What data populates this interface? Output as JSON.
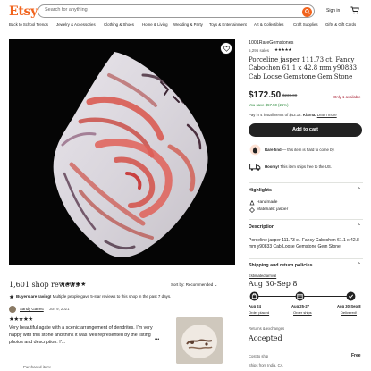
{
  "header": {
    "logo": "Etsy",
    "search_placeholder": "Search for anything",
    "sign_in": "Sign in"
  },
  "nav": [
    "Back to School Trends",
    "Jewelry & Accessories",
    "Clothing & Shoes",
    "Home & Living",
    "Wedding & Party",
    "Toys & Entertainment",
    "Art & Collectibles",
    "Craft Supplies",
    "Gifts & Gift Cards"
  ],
  "listing": {
    "shop_name": "1001RareGemstones",
    "sales": "5,296 sales",
    "rating_stars": "★★★★★",
    "title": "Porceline jasper 111.73 ct. Fancy Cabochon 61.1 x 42.8 mm y90833 Cab Loose Gemstone Gem Stone",
    "price": "$172.50",
    "original_price": "$230.00",
    "stock": "Only 1 available",
    "savings": "You save $57.50 (25%)",
    "klarna_prefix": "Pay in 4 installments of $43.12.",
    "klarna_brand": "Klarna.",
    "klarna_link": "Learn more",
    "add_to_cart": "Add to cart",
    "rare_bold": "Rare find",
    "rare_text": " — this item is hard to come by.",
    "ship_bold": "Hooray!",
    "ship_text": " This item ships free to the US."
  },
  "highlights": {
    "title": "Highlights",
    "items": [
      "Handmade",
      "Materials: jasper"
    ]
  },
  "description": {
    "title": "Description",
    "text": "Porceline jasper 111.73 ct. Fancy Cabochon 61.1 x 42.8 mm y90833 Cab Loose Gemstone Gem Stone"
  },
  "shipping": {
    "title": "Shipping and return policies",
    "estimated_label": "Estimated arrival",
    "estimated_range": "Aug 30-Sep 8",
    "steps": [
      {
        "date": "Aug 24",
        "label": "Order placed"
      },
      {
        "date": "Aug 25-27",
        "label": "Order ships"
      },
      {
        "date": "Aug 30-Sep 8",
        "label": "Delivered!"
      }
    ],
    "returns_label": "Returns & exchanges",
    "returns_value": "Accepted",
    "cost_label": "Cost to ship",
    "cost_value": "Free",
    "from_label": "Ships from India, CA"
  },
  "reviews": {
    "title": "1,601 shop reviews",
    "stars": "★★★★★",
    "sort_label": "Sort by: Recommended",
    "buyers_bold": "Buyers are raving!",
    "buyers_text": " Multiple people gave 5-star reviews to this shop in the past 7 days.",
    "review": {
      "user": "Sandy Garrett",
      "date": "Jun 9, 2021",
      "stars": "★★★★★",
      "text": "Very beautiful agate with a scenic arrangement of dendrites. I'm very happy with this stone and think it was well represented by the listing photos and description. I'...",
      "more": "•••",
      "purchased": "Purchased item:"
    }
  },
  "colors": {
    "brand": "#f1641e",
    "button": "#222222",
    "stock_red": "#a61a2e",
    "save_green": "#258635"
  }
}
